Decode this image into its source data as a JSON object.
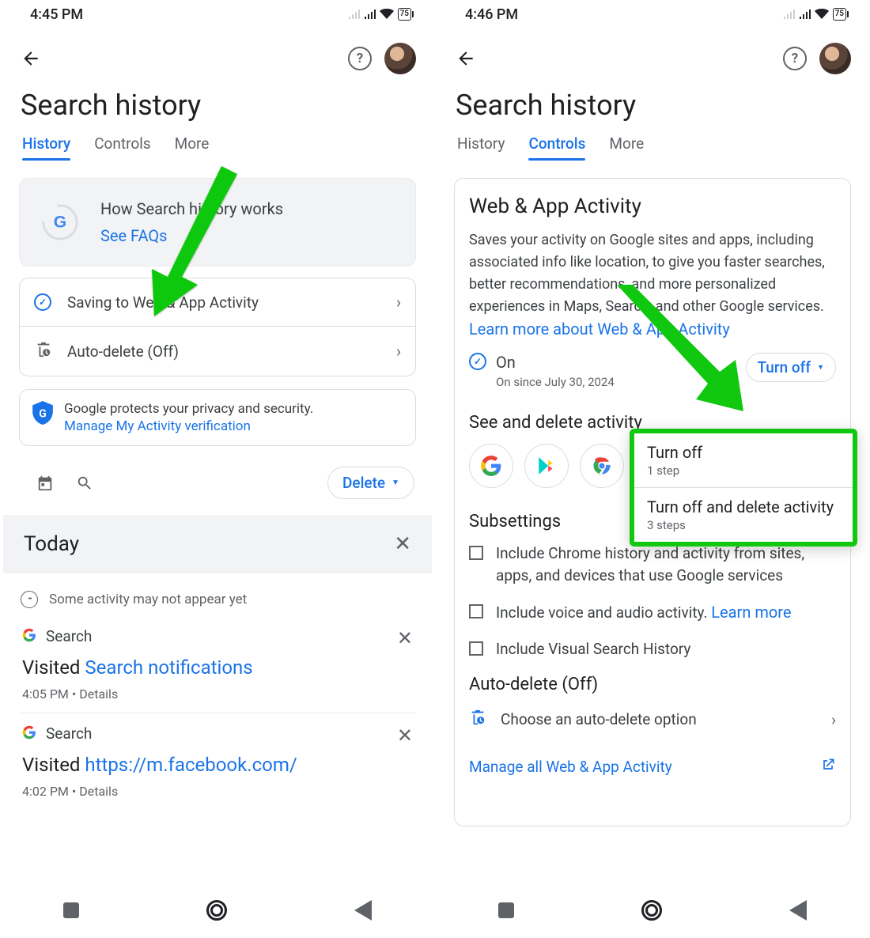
{
  "left": {
    "status": {
      "time": "4:45 PM",
      "battery": "75"
    },
    "title": "Search history",
    "tabs": [
      "History",
      "Controls",
      "More"
    ],
    "active_tab": 0,
    "faq": {
      "heading": "How Search history works",
      "link": "See FAQs"
    },
    "rows": [
      {
        "label": "Saving to Web & App Activity",
        "icon": "check"
      },
      {
        "label": "Auto-delete (Off)",
        "icon": "autodelete"
      }
    ],
    "protect": {
      "text": "Google protects your privacy and security.",
      "link": "Manage My Activity verification"
    },
    "delete_label": "Delete",
    "today_label": "Today",
    "note": "Some activity may not appear yet",
    "entries": [
      {
        "app": "Search",
        "visited_prefix": "Visited ",
        "visited_link": "Search notifications",
        "time": "4:05 PM",
        "details": "Details"
      },
      {
        "app": "Search",
        "visited_prefix": "Visited ",
        "visited_link": "https://m.facebook.com/",
        "time": "4:02 PM",
        "details": "Details"
      }
    ]
  },
  "right": {
    "status": {
      "time": "4:46 PM",
      "battery": "75"
    },
    "title": "Search history",
    "tabs": [
      "History",
      "Controls",
      "More"
    ],
    "active_tab": 1,
    "panel_title": "Web & App Activity",
    "panel_desc": "Saves your activity on Google sites and apps, including associated info like location, to give you faster searches, better recommendations, and more personalized experiences in Maps, Search, and other Google services. ",
    "panel_learn_link": "Learn more about Web & App Activity",
    "on_label": "On",
    "on_since": "On since July 30, 2024",
    "turn_off_label": "Turn off",
    "see_delete_heading": "See and delete activity",
    "apps": [
      "google",
      "play",
      "chrome",
      "gtranslate"
    ],
    "subsettings_heading": "Subsettings",
    "subsettings": [
      {
        "text": "Include Chrome history and activity from sites, apps, and devices that use Google services",
        "link": ""
      },
      {
        "text": "Include voice and audio activity. ",
        "link": "Learn more"
      },
      {
        "text": "Include Visual Search History",
        "link": ""
      }
    ],
    "autodel_heading": "Auto-delete (Off)",
    "autodel_row": "Choose an auto-delete option",
    "manage_link": "Manage all Web & App Activity",
    "popup": [
      {
        "main": "Turn off",
        "sub": "1 step"
      },
      {
        "main": "Turn off and delete activity",
        "sub": "3 steps"
      }
    ]
  }
}
